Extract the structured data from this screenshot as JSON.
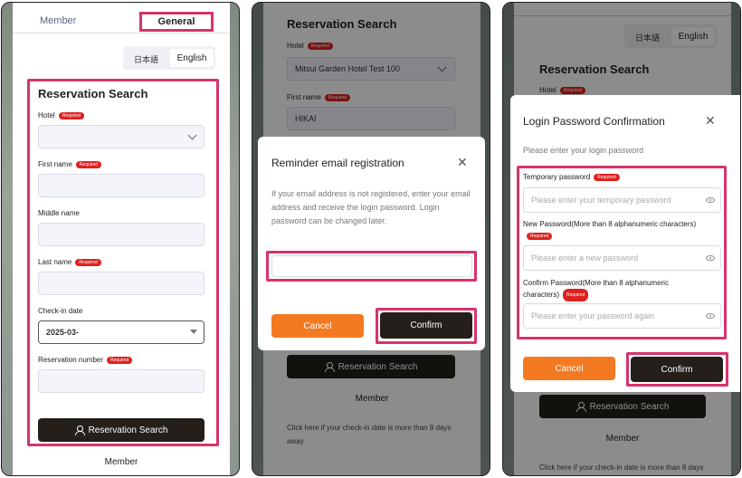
{
  "tabs": {
    "member": "Member",
    "general": "General"
  },
  "lang": {
    "ja": "日本語",
    "en": "English"
  },
  "search_form": {
    "title": "Reservation Search",
    "hotel_label": "Hotel",
    "first_name_label": "First name",
    "middle_name_label": "Middle name",
    "last_name_label": "Last name",
    "checkin_label": "Check-in date",
    "checkin_value": "2025-03-",
    "reservation_number_label": "Reservation number",
    "required": "Required",
    "search_button": "Reservation Search",
    "member_link": "Member"
  },
  "panel2": {
    "bg_title": "Reservation Search",
    "hotel_label": "Hotel",
    "hotel_value": "Mitsui Garden Hotel Test 100",
    "first_name_label": "First name",
    "first_name_value": "HIKAI",
    "search_button": "Reservation Search",
    "member_link": "Member",
    "footer_text": "Click here if your check-in date is more than 8 days away",
    "dialog": {
      "title": "Reminder email registration",
      "body": "If your email address is not registered, enter your email address and receive the login password. Login password can be changed later.",
      "email_value": "",
      "cancel": "Cancel",
      "confirm": "Confirm"
    }
  },
  "panel3": {
    "bg_title": "Reservation Search",
    "hotel_label": "Hotel",
    "search_button": "Reservation Search",
    "member_link": "Member",
    "footer_text": "Click here if your check-in date is more than 8 days away",
    "dialog": {
      "title": "Login Password Confirmation",
      "subtitle": "Please enter your login password",
      "temp_label": "Temporary password",
      "temp_placeholder": "Please enter your temporary password",
      "new_label": "New Password(More than 8 alphanumeric characters)",
      "new_placeholder": "Please enter a new password",
      "confirm_label": "Confirm Password(More than 8 alphanumeric characters)",
      "confirm_placeholder": "Please enter your password again",
      "cancel": "Cancel",
      "confirm": "Confirm"
    }
  },
  "colors": {
    "accent_pink": "#d6336c",
    "dark_button": "#241f1b",
    "orange_button": "#f47a21",
    "required_red": "#e02020"
  }
}
